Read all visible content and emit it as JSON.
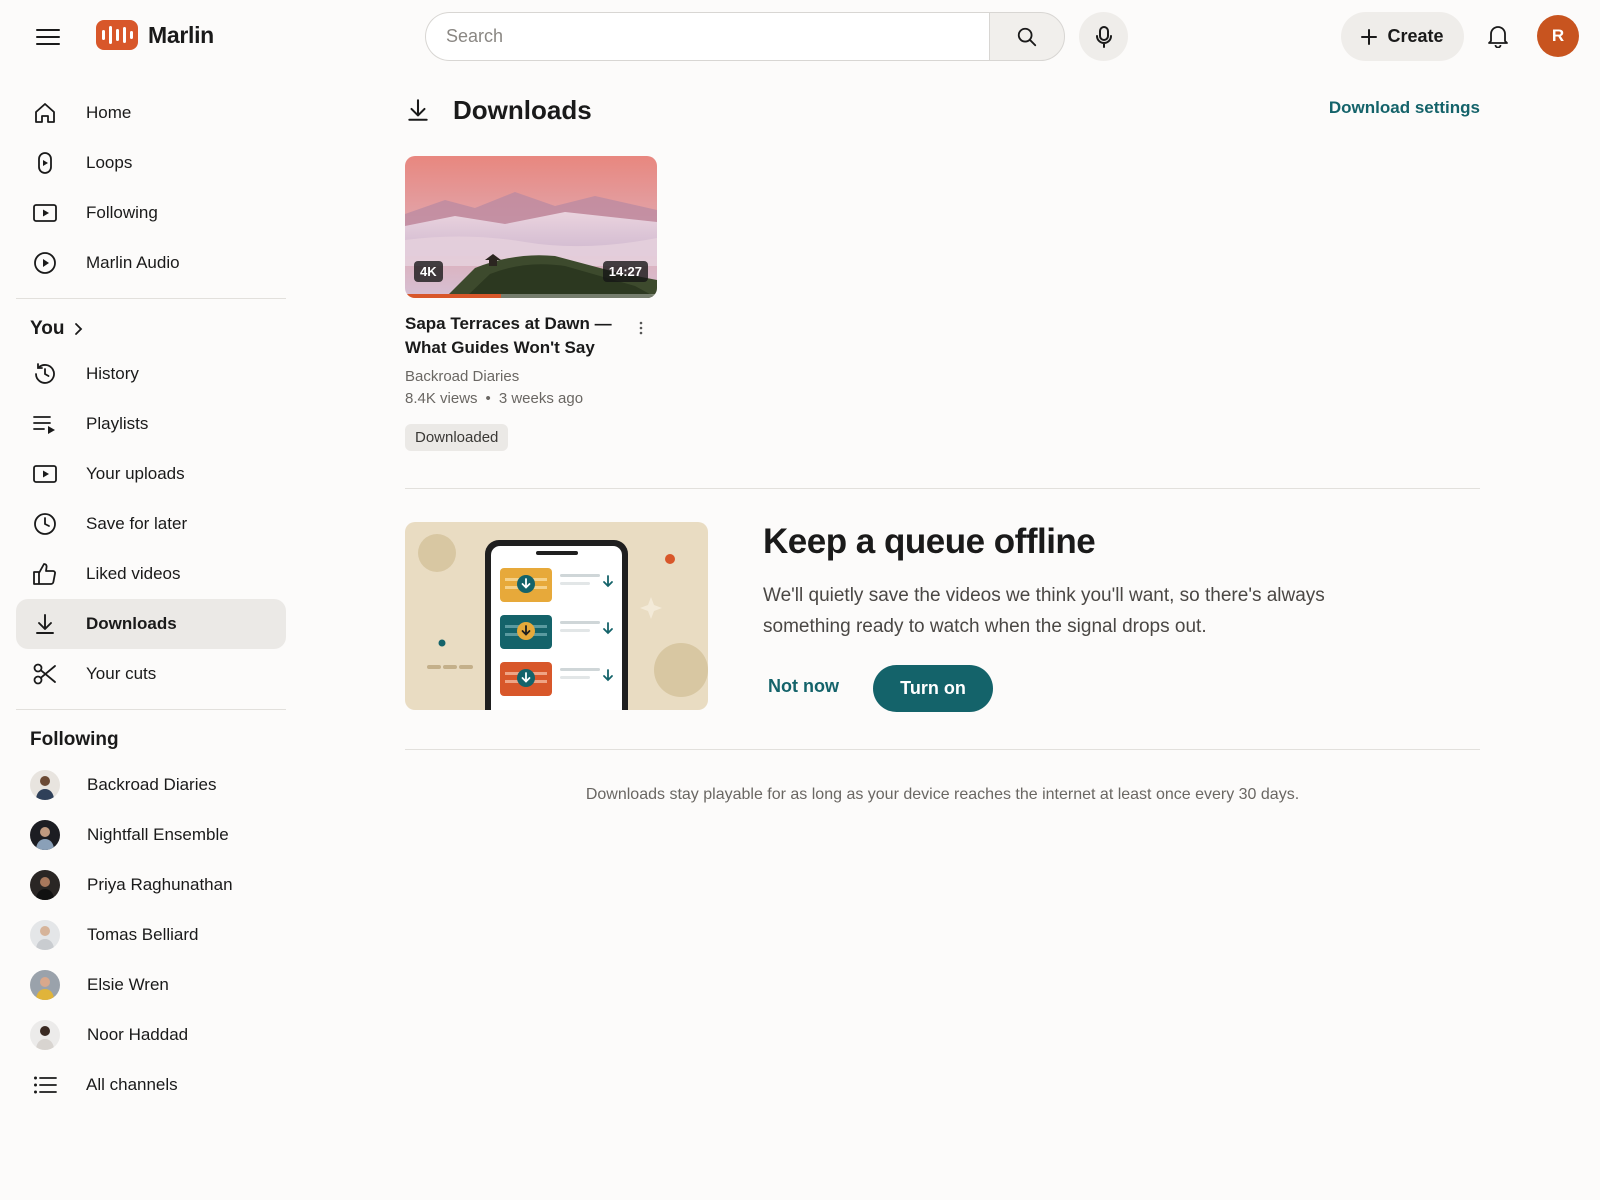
{
  "app": {
    "name": "Marlin",
    "brand_color": "#d8572a",
    "accent_color": "#14636a"
  },
  "header": {
    "search_placeholder": "Search",
    "create_label": "Create",
    "avatar_initial": "R"
  },
  "sidebar": {
    "main": [
      {
        "label": "Home",
        "icon": "home-icon"
      },
      {
        "label": "Loops",
        "icon": "loops-icon"
      },
      {
        "label": "Following",
        "icon": "subscriptions-icon"
      },
      {
        "label": "Marlin Audio",
        "icon": "play-circle-icon"
      }
    ],
    "you_heading": "You",
    "you": [
      {
        "label": "History",
        "icon": "history-icon"
      },
      {
        "label": "Playlists",
        "icon": "playlists-icon"
      },
      {
        "label": "Your uploads",
        "icon": "uploads-icon"
      },
      {
        "label": "Save for later",
        "icon": "clock-icon"
      },
      {
        "label": "Liked videos",
        "icon": "thumbs-up-icon"
      },
      {
        "label": "Downloads",
        "icon": "download-icon",
        "active": true
      },
      {
        "label": "Your cuts",
        "icon": "scissors-icon"
      }
    ],
    "following_heading": "Following",
    "following": [
      {
        "label": "Backroad Diaries"
      },
      {
        "label": "Nightfall Ensemble"
      },
      {
        "label": "Priya Raghunathan"
      },
      {
        "label": "Tomas Belliard"
      },
      {
        "label": "Elsie Wren"
      },
      {
        "label": "Noor Haddad"
      }
    ],
    "all_channels": "All channels"
  },
  "main": {
    "title": "Downloads",
    "settings_link": "Download settings",
    "video": {
      "title": "Sapa Terraces at Dawn — What Guides Won't Say",
      "channel": "Backroad Diaries",
      "views": "8.4K views",
      "age": "3 weeks ago",
      "quality_badge": "4K",
      "duration": "14:27",
      "watch_progress": 0.38,
      "status_chip": "Downloaded"
    },
    "promo": {
      "title": "Keep a queue offline",
      "body": "We'll quietly save the videos we think you'll want, so there's always something ready to watch when the signal drops out.",
      "dismiss_label": "Not now",
      "confirm_label": "Turn on"
    },
    "footnote": "Downloads stay playable for as long as your device reaches the internet at least once every 30 days."
  }
}
